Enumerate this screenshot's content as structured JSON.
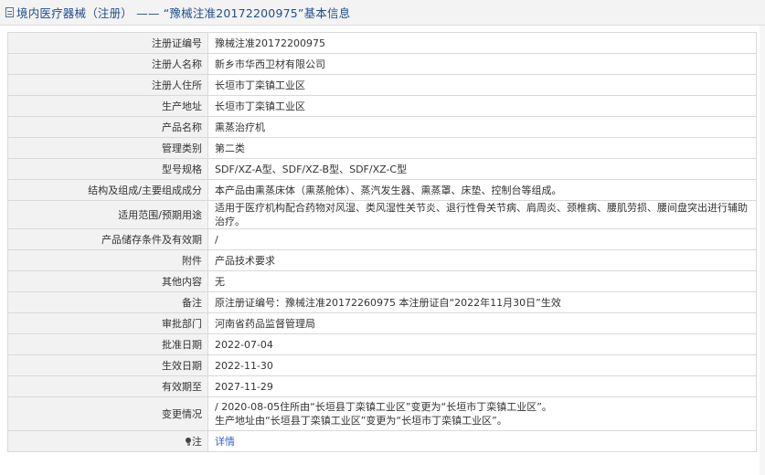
{
  "page": {
    "title": "境内医疗器械（注册） —— “豫械注准20172200975”基本信息"
  },
  "rows": [
    {
      "label": "注册证编号",
      "value": "豫械注准20172200975"
    },
    {
      "label": "注册人名称",
      "value": "新乡市华西卫材有限公司"
    },
    {
      "label": "注册人住所",
      "value": "长垣市丁栾镇工业区"
    },
    {
      "label": "生产地址",
      "value": "长垣市丁栾镇工业区"
    },
    {
      "label": "产品名称",
      "value": "熏蒸治疗机"
    },
    {
      "label": "管理类别",
      "value": "第二类"
    },
    {
      "label": "型号规格",
      "value": "SDF/XZ-A型、SDF/XZ-B型、SDF/XZ-C型"
    },
    {
      "label": "结构及组成/主要组成成分",
      "value": "本产品由熏蒸床体（熏蒸舱体）、蒸汽发生器、熏蒸罩、床垫、控制台等组成。"
    },
    {
      "label": "适用范围/预期用途",
      "value": "适用于医疗机构配合药物对风湿、类风湿性关节炎、退行性骨关节病、肩周炎、颈椎病、腰肌劳损、腰间盘突出进行辅助治疗。"
    },
    {
      "label": "产品储存条件及有效期",
      "value": "/"
    },
    {
      "label": "附件",
      "value": "产品技术要求"
    },
    {
      "label": "其他内容",
      "value": "无"
    },
    {
      "label": "备注",
      "value": "原注册证编号：豫械注准20172260975 本注册证自“2022年11月30日”生效"
    },
    {
      "label": "审批部门",
      "value": "河南省药品监督管理局"
    },
    {
      "label": "批准日期",
      "value": "2022-07-04"
    },
    {
      "label": "生效日期",
      "value": "2022-11-30"
    },
    {
      "label": "有效期至",
      "value": "2027-11-29"
    }
  ],
  "changes": {
    "label": "变更情况",
    "line1": " / 2020-08-05住所由“长垣县丁栾镇工业区”变更为“长垣市丁栾镇工业区”。",
    "line2": "生产地址由“长垣县丁栾镇工业区”变更为“长垣市丁栾镇工业区”。"
  },
  "detail": {
    "icon": "bulb-icon",
    "label": "注",
    "link": "详情"
  }
}
